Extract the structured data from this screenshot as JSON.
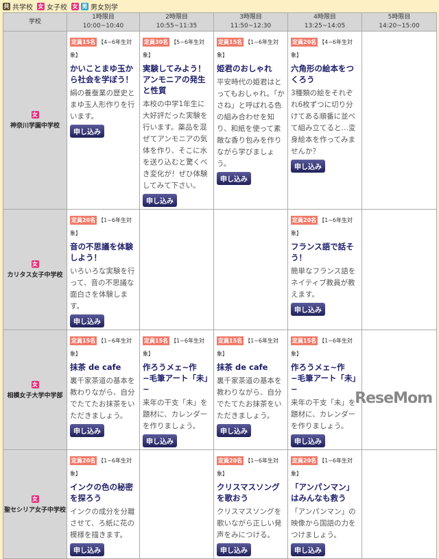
{
  "legend": [
    {
      "icon": "共",
      "label": "共学校",
      "cls": "co"
    },
    {
      "icon": "女",
      "label": "女子校",
      "cls": "g"
    },
    {
      "icon": "女男",
      "label": "男女別学",
      "cls": "b"
    }
  ],
  "header": {
    "school": "学校",
    "periods": [
      {
        "name": "1時限目",
        "time": "10:00~10:40"
      },
      {
        "name": "2時限目",
        "time": "10:55~11:35"
      },
      {
        "name": "3時限目",
        "time": "11:50~12:30"
      },
      {
        "name": "4時限目",
        "time": "13:25~14:05"
      },
      {
        "name": "5時限目",
        "time": "14:20~15:00"
      }
    ]
  },
  "apply_label": "申し込み",
  "rows": [
    {
      "type": "女",
      "school": "神奈川学園中学校",
      "cells": [
        {
          "cap": "定員15名",
          "target": "【4~6年生対象】",
          "title": "かいことまゆ玉から社会を学ぼう！",
          "desc": "絹の養蚕業の歴史とまゆ玉人形作りを行います。"
        },
        {
          "cap": "定員30名",
          "target": "【5~6年生対象】",
          "title": "実験してみよう！アンモニアの発生と性質",
          "desc": "本校の中学1年生に大好評だった実験を行います。薬品を混ぜてアンモニアの気体を作り、そこに水を送り込むと驚くべき変化が！ぜひ体験してみて下さい。"
        },
        {
          "cap": "定員15名",
          "target": "【1~6年生対象】",
          "title": "姫君のおしゃれ",
          "desc": "平安時代の姫君はとってもおしゃれ。「かさね」と呼ばれる色の組み合わせを知り、和紙を使って素敵な香り包みを作りながら学びましょう。"
        },
        {
          "cap": "定員20名",
          "target": "【4~6年生対象】",
          "title": "六角形の絵本をつくろう",
          "desc": "3種類の絵をそれぞれ6枚ずつに切り分けてある順番に並べて組み立てると…変身絵本を作ってみませんか？"
        },
        null
      ]
    },
    {
      "type": "女",
      "school": "カリタス女子中学校",
      "cells": [
        {
          "cap": "定員20名",
          "target": "【1~6年生対象】",
          "title": "音の不思議を体験しよう！",
          "desc": "いろいろな実験を行って、音の不思議な面白さを体験します。"
        },
        null,
        null,
        {
          "cap": "定員20名",
          "target": "【1~6年生対象】",
          "title": "フランス語で話そう！",
          "desc": "簡単なフランス語をネイティブ教員が教えます。"
        },
        null
      ]
    },
    {
      "type": "女",
      "school": "相模女子大学中学部",
      "cells": [
        {
          "cap": "定員15名",
          "target": "【1~6年生対象】",
          "title": "抹茶 de cafe",
          "desc": "裏千家茶道の基本を教わりながら、自分でたてたお抹茶をいただきましょう。"
        },
        {
          "cap": "定員15名",
          "target": "【1~6年生対象】",
          "title": "作ろうメェ~作 −毛筆アート「未」−",
          "desc": "来年の干支「未」を題材に、カレンダーを作りましょう。"
        },
        {
          "cap": "定員15名",
          "target": "【1~6年生対象】",
          "title": "抹茶 de cafe",
          "desc": "裏千家茶道の基本を教わりながら、自分でたてたお抹茶をいただきましょう。"
        },
        {
          "cap": "定員15名",
          "target": "【1~6年生対象】",
          "title": "作ろうメェ~作 −毛筆アート「未」−",
          "desc": "来年の干支「未」を題材に、カレンダーを作りましょう。"
        },
        null
      ]
    },
    {
      "type": "女",
      "school": "聖セシリア女子中学校",
      "cells": [
        {
          "cap": "定員20名",
          "target": "【1~6年生対象】",
          "title": "インクの色の秘密を探ろう",
          "desc": "インクの成分を分離させて、ろ紙に花の模様を描きます。"
        },
        null,
        {
          "cap": "定員20名",
          "target": "【1~6年生対象】",
          "title": "クリスマスソングを歌おう",
          "desc": "クリスマスソングを歌いながら正しい発声をみにつける。"
        },
        {
          "cap": "定員20名",
          "target": "【1~6年生対象】",
          "title": "「アンパンマン」はみんなも救う",
          "desc": "「アンパンマン」の映像から国語の力をつけましょう。"
        },
        null
      ]
    }
  ],
  "watermark": "ReseMom"
}
